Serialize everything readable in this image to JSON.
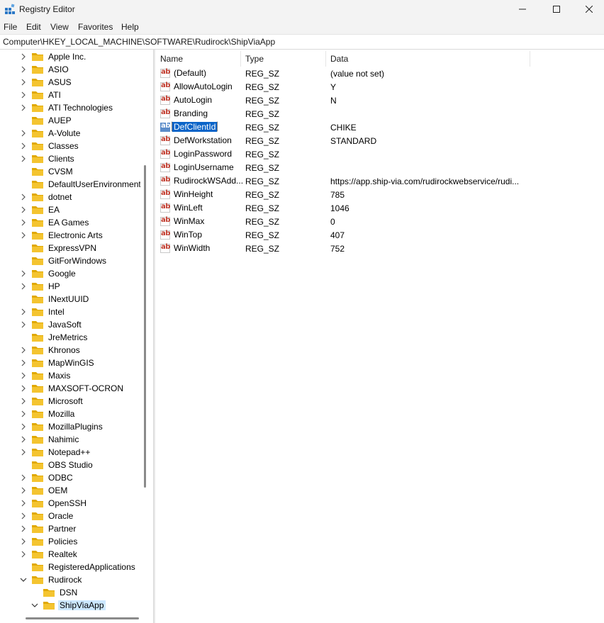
{
  "window": {
    "title": "Registry Editor",
    "icon": "registry-icon",
    "controls": [
      "minimize-icon",
      "maximize-icon",
      "close-icon"
    ]
  },
  "menu": [
    "File",
    "Edit",
    "View",
    "Favorites",
    "Help"
  ],
  "address": "Computer\\HKEY_LOCAL_MACHINE\\SOFTWARE\\Rudirock\\ShipViaApp",
  "tree": {
    "items": [
      {
        "label": "Apple Inc.",
        "expand": "collapsed"
      },
      {
        "label": "ASIO",
        "expand": "collapsed"
      },
      {
        "label": "ASUS",
        "expand": "collapsed"
      },
      {
        "label": "ATI",
        "expand": "collapsed"
      },
      {
        "label": "ATI Technologies",
        "expand": "collapsed"
      },
      {
        "label": "AUEP",
        "expand": "none"
      },
      {
        "label": "A-Volute",
        "expand": "collapsed"
      },
      {
        "label": "Classes",
        "expand": "collapsed"
      },
      {
        "label": "Clients",
        "expand": "collapsed"
      },
      {
        "label": "CVSM",
        "expand": "none"
      },
      {
        "label": "DefaultUserEnvironment",
        "expand": "none"
      },
      {
        "label": "dotnet",
        "expand": "collapsed"
      },
      {
        "label": "EA",
        "expand": "collapsed"
      },
      {
        "label": "EA Games",
        "expand": "collapsed"
      },
      {
        "label": "Electronic Arts",
        "expand": "collapsed"
      },
      {
        "label": "ExpressVPN",
        "expand": "none"
      },
      {
        "label": "GitForWindows",
        "expand": "none"
      },
      {
        "label": "Google",
        "expand": "collapsed"
      },
      {
        "label": "HP",
        "expand": "collapsed"
      },
      {
        "label": "INextUUID",
        "expand": "none"
      },
      {
        "label": "Intel",
        "expand": "collapsed"
      },
      {
        "label": "JavaSoft",
        "expand": "collapsed"
      },
      {
        "label": "JreMetrics",
        "expand": "none"
      },
      {
        "label": "Khronos",
        "expand": "collapsed"
      },
      {
        "label": "MapWinGIS",
        "expand": "collapsed"
      },
      {
        "label": "Maxis",
        "expand": "collapsed"
      },
      {
        "label": "MAXSOFT-OCRON",
        "expand": "collapsed"
      },
      {
        "label": "Microsoft",
        "expand": "collapsed"
      },
      {
        "label": "Mozilla",
        "expand": "collapsed"
      },
      {
        "label": "MozillaPlugins",
        "expand": "collapsed"
      },
      {
        "label": "Nahimic",
        "expand": "collapsed"
      },
      {
        "label": "Notepad++",
        "expand": "collapsed"
      },
      {
        "label": "OBS Studio",
        "expand": "none"
      },
      {
        "label": "ODBC",
        "expand": "collapsed"
      },
      {
        "label": "OEM",
        "expand": "collapsed"
      },
      {
        "label": "OpenSSH",
        "expand": "collapsed"
      },
      {
        "label": "Oracle",
        "expand": "collapsed"
      },
      {
        "label": "Partner",
        "expand": "collapsed"
      },
      {
        "label": "Policies",
        "expand": "collapsed"
      },
      {
        "label": "Realtek",
        "expand": "collapsed"
      },
      {
        "label": "RegisteredApplications",
        "expand": "none"
      },
      {
        "label": "Rudirock",
        "expand": "expanded"
      },
      {
        "label": "DSN",
        "expand": "none",
        "child": true
      },
      {
        "label": "ShipViaApp",
        "expand": "expanded",
        "child": true,
        "selected": true
      }
    ]
  },
  "list": {
    "columns": [
      "Name",
      "Type",
      "Data"
    ],
    "rows": [
      {
        "name": "(Default)",
        "type": "REG_SZ",
        "data": "(value not set)"
      },
      {
        "name": "AllowAutoLogin",
        "type": "REG_SZ",
        "data": "Y"
      },
      {
        "name": "AutoLogin",
        "type": "REG_SZ",
        "data": "N"
      },
      {
        "name": "Branding",
        "type": "REG_SZ",
        "data": ""
      },
      {
        "name": "DefClientId",
        "type": "REG_SZ",
        "data": "CHIKE",
        "selected": true
      },
      {
        "name": "DefWorkstation",
        "type": "REG_SZ",
        "data": "STANDARD"
      },
      {
        "name": "LoginPassword",
        "type": "REG_SZ",
        "data": ""
      },
      {
        "name": "LoginUsername",
        "type": "REG_SZ",
        "data": ""
      },
      {
        "name": "RudirockWSAdd...",
        "type": "REG_SZ",
        "data": "https://app.ship-via.com/rudirockwebservice/rudi..."
      },
      {
        "name": "WinHeight",
        "type": "REG_SZ",
        "data": "785"
      },
      {
        "name": "WinLeft",
        "type": "REG_SZ",
        "data": "1046"
      },
      {
        "name": "WinMax",
        "type": "REG_SZ",
        "data": "0"
      },
      {
        "name": "WinTop",
        "type": "REG_SZ",
        "data": "407"
      },
      {
        "name": "WinWidth",
        "type": "REG_SZ",
        "data": "752"
      }
    ]
  },
  "colors": {
    "chrome": "#f3f3f3",
    "folder": "#f4c430",
    "selection": "#0a64c8",
    "tree_selection": "#cce8ff"
  }
}
